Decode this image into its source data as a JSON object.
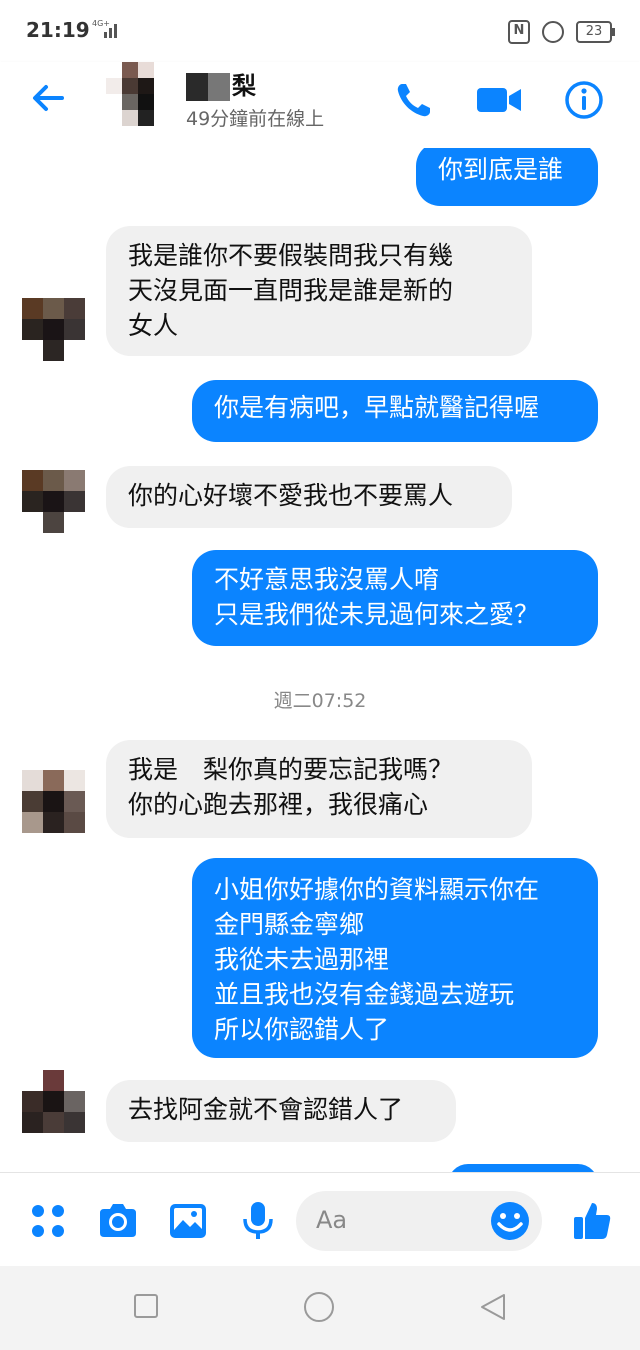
{
  "status_bar": {
    "time": "21:19",
    "network": "4G+",
    "battery": "23"
  },
  "header": {
    "contact_name_suffix": "梨",
    "presence": "49分鐘前在線上"
  },
  "messages": [
    {
      "side": "me",
      "text": "你到底是誰"
    },
    {
      "side": "them",
      "text": "我是誰你不要假裝問我只有幾天沒見面一直問我是誰是新的女人"
    },
    {
      "side": "me",
      "text": "你是有病吧，早點就醫記得喔"
    },
    {
      "side": "them",
      "text": "你的心好壞不愛我也不要罵人"
    },
    {
      "side": "me",
      "text": "不好意思我沒罵人唷 只是我們從未見過何來之愛？"
    },
    {
      "side": "them",
      "text": "我是　梨你真的要忘記我嗎？ 你的心跑去那裡，我很痛心"
    },
    {
      "side": "me",
      "text": "小姐你好據你的資料顯示你在 金門縣金寧鄉 我從未去過那裡 並且我也沒有金錢過去遊玩 所以你認錯人了"
    },
    {
      "side": "them",
      "text": "去找阿金就不會認錯人了"
    }
  ],
  "bubble_lines": {
    "m1": [
      "你到底是誰"
    ],
    "t1": [
      "我是誰你不要假裝問我只有幾",
      "天沒見面一直問我是誰是新的",
      "女人"
    ],
    "m2": [
      "你是有病吧，早點就醫記得喔"
    ],
    "t2": [
      "你的心好壞不愛我也不要罵人"
    ],
    "m3": [
      "不好意思我沒罵人唷",
      "只是我們從未見過何來之愛？"
    ],
    "t3": [
      "我是　梨你真的要忘記我嗎？",
      "你的心跑去那裡，我很痛心"
    ],
    "m4": [
      "小姐你好據你的資料顯示你在",
      "金門縣金寧鄉",
      "我從未去過那裡",
      "並且我也沒有金錢過去遊玩",
      "所以你認錯人了"
    ],
    "t4": [
      "去找阿金就不會認錯人了"
    ]
  },
  "timestamp": "週二07:52",
  "composer": {
    "placeholder": "Aa"
  },
  "icons": {
    "back": "arrow-left-icon",
    "call": "phone-icon",
    "video": "video-camera-icon",
    "info": "info-icon",
    "more": "four-dots-icon",
    "camera": "camera-icon",
    "gallery": "image-icon",
    "mic": "microphone-icon",
    "emoji": "smiley-icon",
    "like": "thumbs-up-icon"
  },
  "colors": {
    "accent": "#0b84ff",
    "incoming_bubble": "#f0f0f0"
  }
}
